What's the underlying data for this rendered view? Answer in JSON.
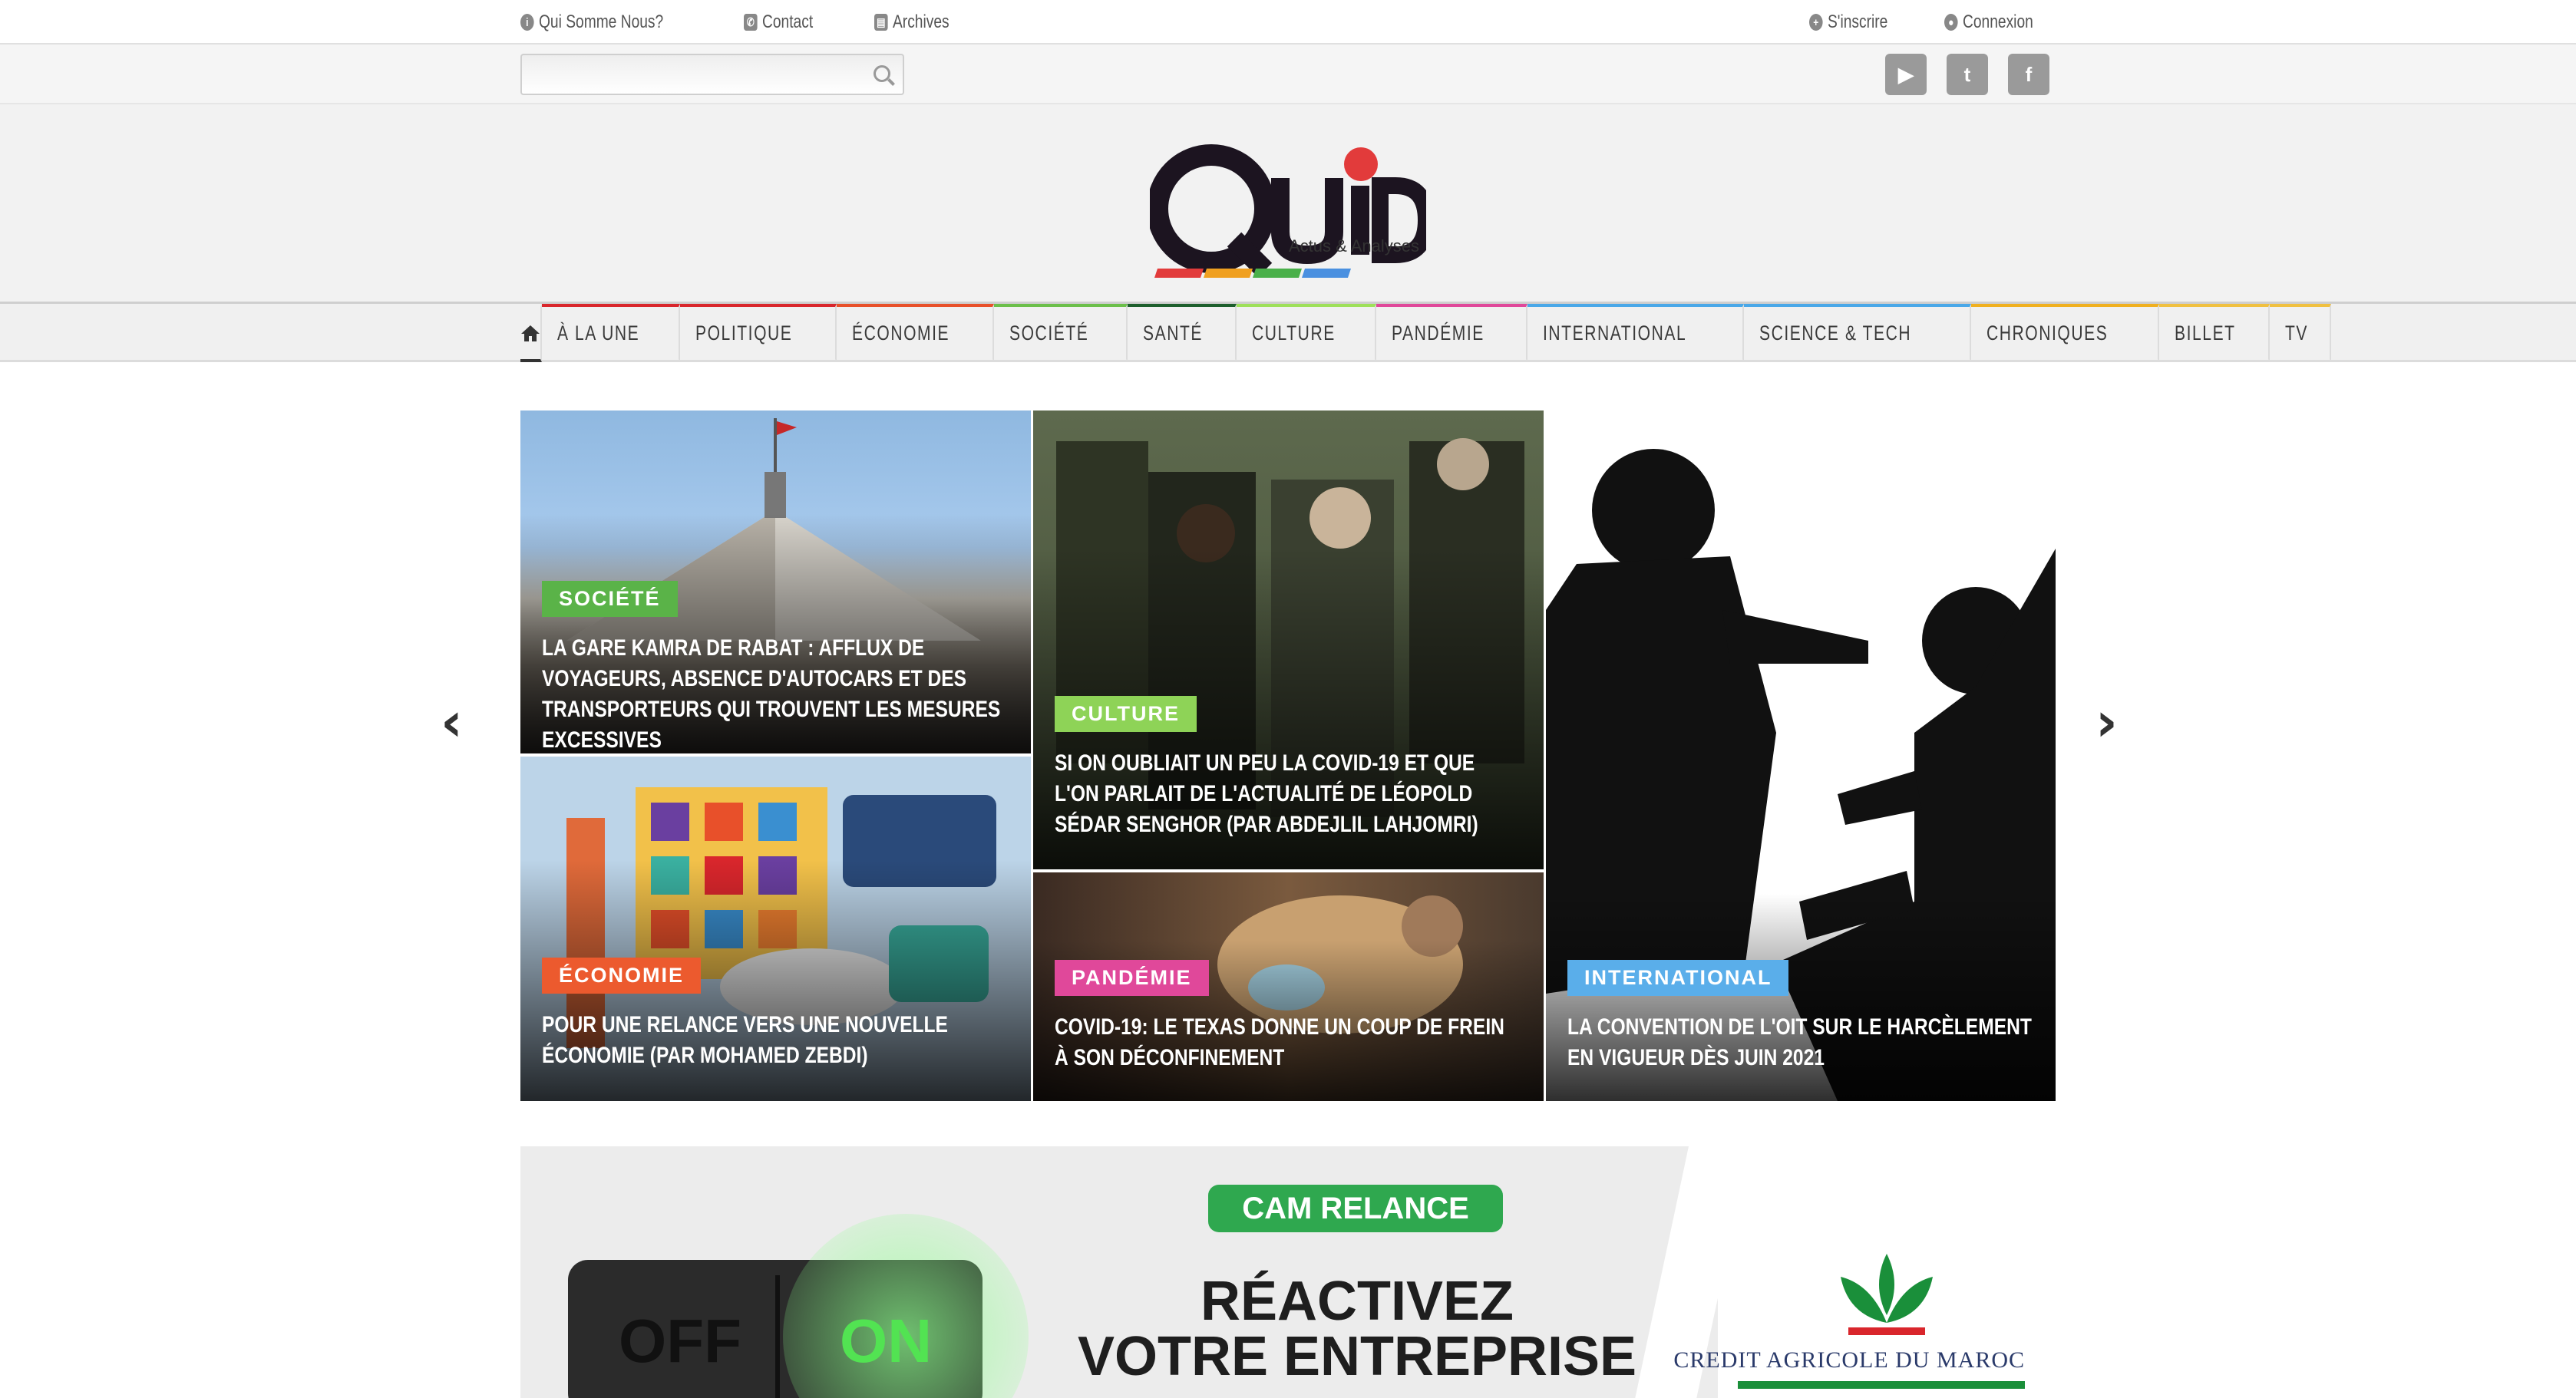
{
  "topbar": {
    "left_links": [
      {
        "label": "Qui Somme Nous?",
        "icon": "info-icon"
      },
      {
        "label": "Contact",
        "icon": "phone-icon"
      },
      {
        "label": "Archives",
        "icon": "archive-icon"
      }
    ],
    "right_links": [
      {
        "label": "S'inscrire",
        "icon": "user-plus-icon"
      },
      {
        "label": "Connexion",
        "icon": "user-icon"
      }
    ]
  },
  "search": {
    "placeholder": "",
    "value": ""
  },
  "socials": [
    {
      "name": "youtube",
      "glyph": "▶"
    },
    {
      "name": "twitter",
      "glyph": "t"
    },
    {
      "name": "facebook",
      "glyph": "f"
    }
  ],
  "logo": {
    "text": "QUID",
    "tagline": "Actus & Analyses",
    "dot_color": "#e23b3b"
  },
  "nav": {
    "items": [
      {
        "label": "À LA UNE",
        "color": "#d9262c"
      },
      {
        "label": "POLITIQUE",
        "color": "#d9262c"
      },
      {
        "label": "ÉCONOMIE",
        "color": "#e8502a"
      },
      {
        "label": "SOCIÉTÉ",
        "color": "#6bbf4a"
      },
      {
        "label": "SANTÉ",
        "color": "#1c5e2c"
      },
      {
        "label": "CULTURE",
        "color": "#9ee05a"
      },
      {
        "label": "PANDÉMIE",
        "color": "#e0489a"
      },
      {
        "label": "INTERNATIONAL",
        "color": "#4aa8e8"
      },
      {
        "label": "SCIENCE & TECH",
        "color": "#4aa8e8"
      },
      {
        "label": "CHRONIQUES",
        "color": "#f0b020"
      },
      {
        "label": "BILLET",
        "color": "#f0c040"
      },
      {
        "label": "TV",
        "color": "#f0c040"
      }
    ]
  },
  "slider": {
    "tiles": [
      {
        "category": "SOCIÉTÉ",
        "cat_color": "#5ab348",
        "title": "LA GARE KAMRA DE RABAT : AFFLUX DE VOYAGEURS, ABSENCE D'AUTOCARS ET DES TRANSPORTEURS QUI TROUVENT LES MESURES EXCESSIVES"
      },
      {
        "category": "CULTURE",
        "cat_color": "#8ed357",
        "title": "SI ON OUBLIAIT UN PEU LA COVID-19 ET QUE L'ON PARLAIT DE L'ACTUALITÉ DE LÉOPOLD SÉDAR SENGHOR (PAR ABDEJLIL LAHJOMRI)"
      },
      {
        "category": "INTERNATIONAL",
        "cat_color": "#5aaeea",
        "title": "LA CONVENTION DE L'OIT SUR LE HARCÈLEMENT EN VIGUEUR DÈS JUIN 2021"
      },
      {
        "category": "ÉCONOMIE",
        "cat_color": "#ec5a2e",
        "title": "POUR UNE RELANCE VERS UNE NOUVELLE ÉCONOMIE (PAR MOHAMED ZEBDI)"
      },
      {
        "category": "PANDÉMIE",
        "cat_color": "#e0489a",
        "title": "COVID-19: LE TEXAS DONNE UN COUP DE FREIN À SON DÉCONFINEMENT"
      }
    ]
  },
  "banner": {
    "badge": "CAM RELANCE",
    "headline_1": "RÉACTIVEZ",
    "headline_2": "VOTRE ENTREPRISE",
    "switch_off": "OFF",
    "switch_on": "ON",
    "bank": "CREDIT AGRICOLE DU MAROC"
  }
}
